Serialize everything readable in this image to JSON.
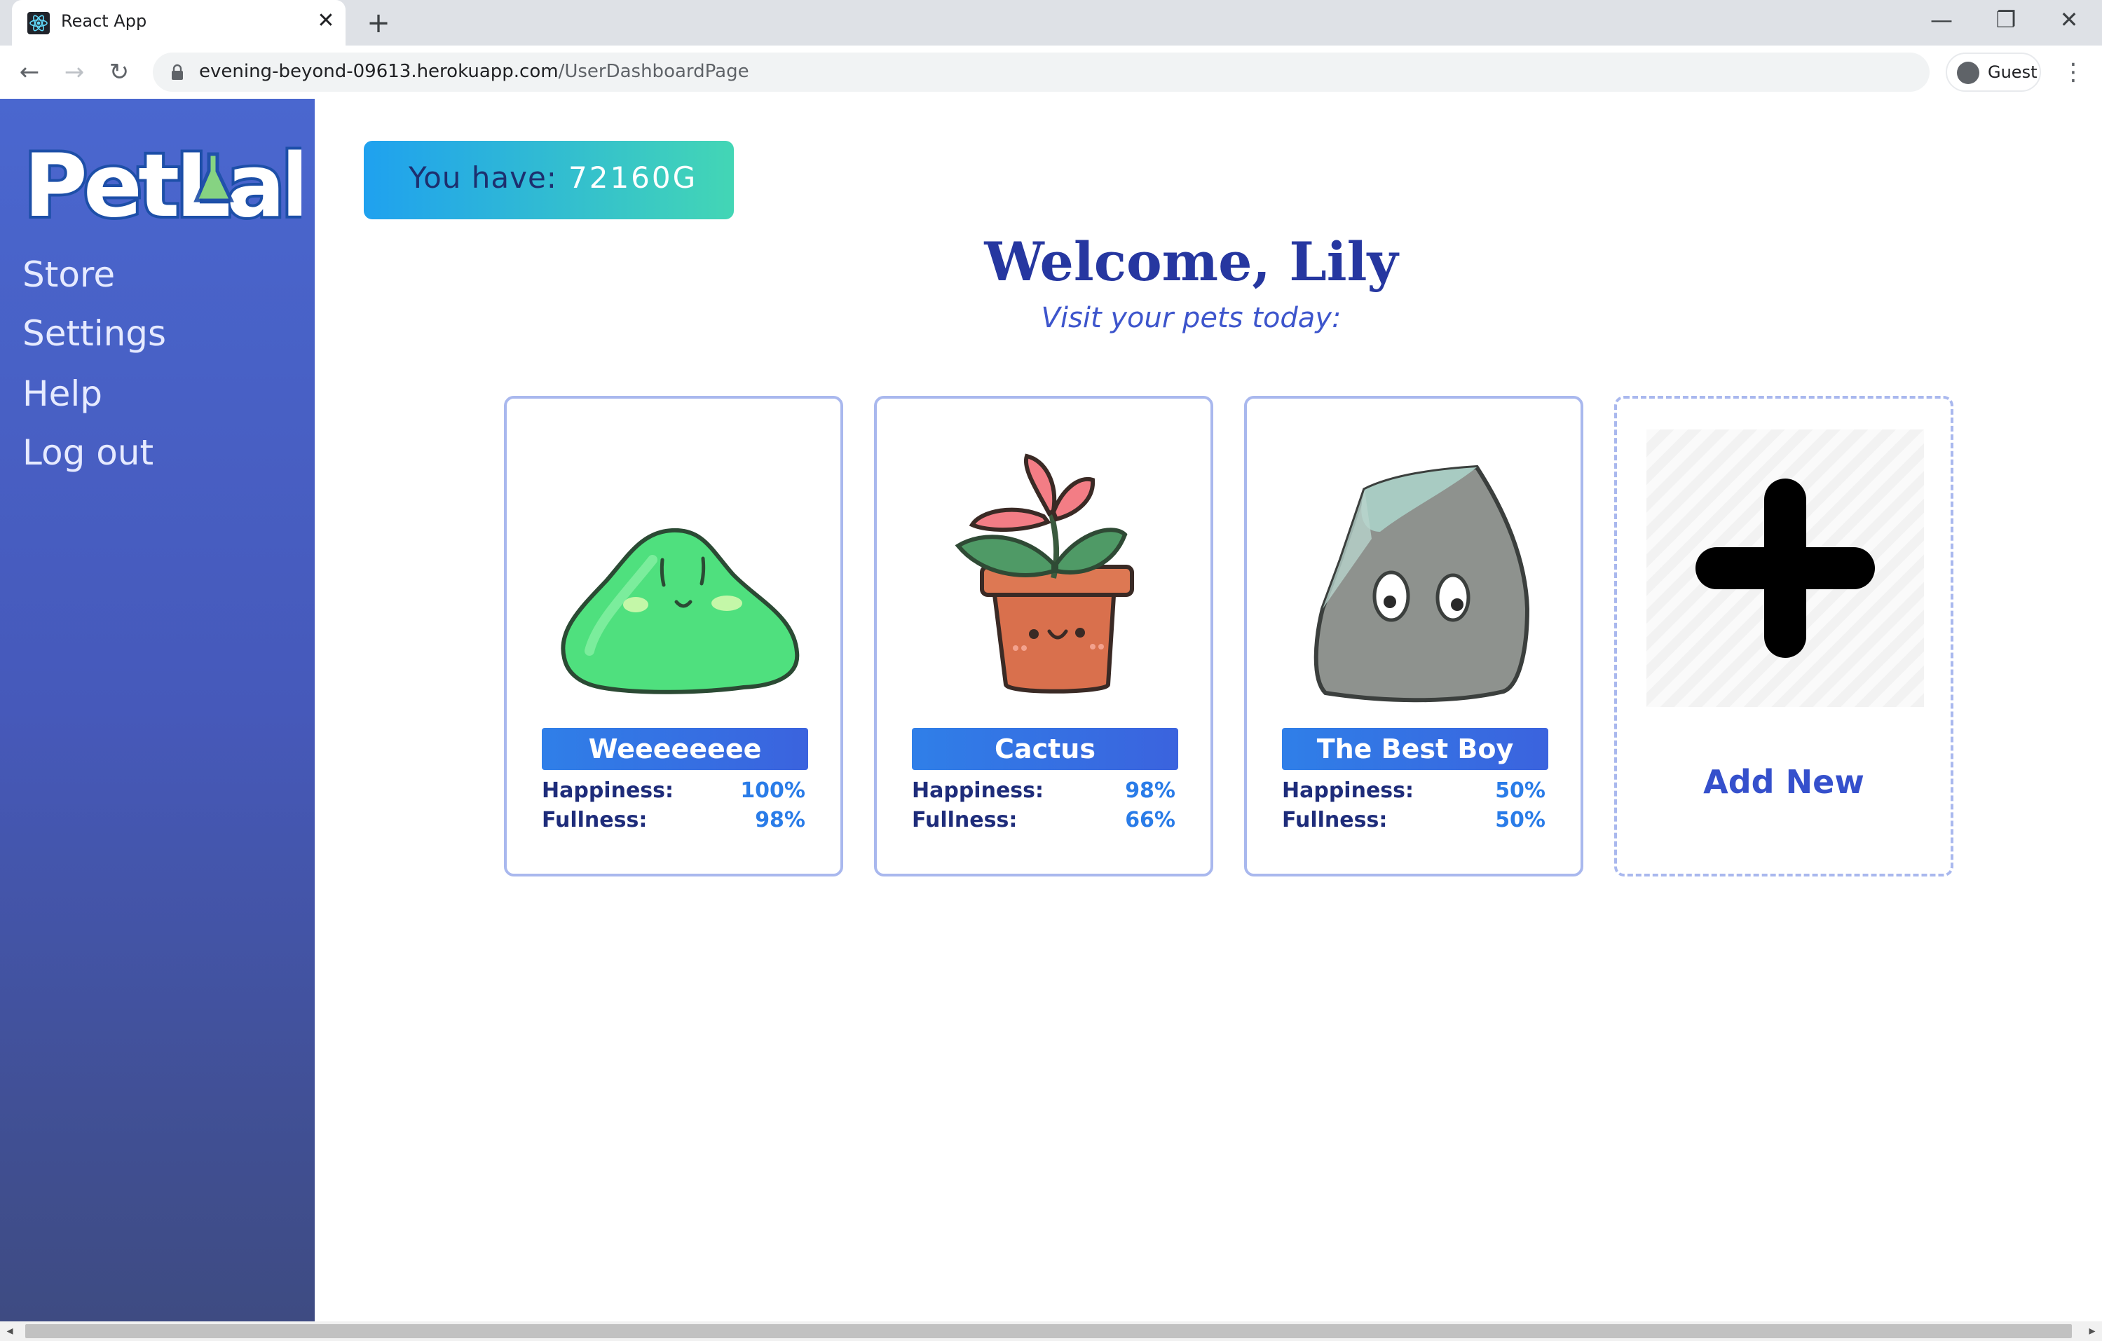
{
  "browser": {
    "tab_title": "React App",
    "tab_close": "✕",
    "new_tab": "+",
    "url_host": "evening-beyond-09613.herokuapp.com",
    "url_path": "/UserDashboardPage",
    "profile_label": "Guest",
    "window_controls": {
      "minimize": "—",
      "restore": "❐",
      "close": "✕"
    },
    "nav": {
      "back": "←",
      "forward": "→",
      "reload": "↻",
      "menu": "⋮"
    }
  },
  "sidebar": {
    "logo_text": "PetLabs",
    "items": [
      {
        "label": "Store"
      },
      {
        "label": "Settings"
      },
      {
        "label": "Help"
      },
      {
        "label": "Log out"
      }
    ]
  },
  "wallet": {
    "label": "You have:",
    "value": "72160G"
  },
  "header": {
    "title": "Welcome, Lily",
    "subtitle": "Visit your pets today:"
  },
  "pets": [
    {
      "name": "Weeeeeeee",
      "kind": "slime-icon",
      "happiness_label": "Happiness:",
      "happiness": "100%",
      "fullness_label": "Fullness:",
      "fullness": "98%"
    },
    {
      "name": "Cactus",
      "kind": "potted-flower-icon",
      "happiness_label": "Happiness:",
      "happiness": "98%",
      "fullness_label": "Fullness:",
      "fullness": "66%"
    },
    {
      "name": "The Best Boy",
      "kind": "rock-icon",
      "happiness_label": "Happiness:",
      "happiness": "50%",
      "fullness_label": "Fullness:",
      "fullness": "50%"
    }
  ],
  "add_new": {
    "label": "Add New"
  },
  "colors": {
    "sidebar_top": "#4a67cf",
    "sidebar_bottom": "#3e4b82",
    "title": "#2637a0",
    "accent": "#2a7ce8",
    "card_border": "#a9b8ee"
  }
}
